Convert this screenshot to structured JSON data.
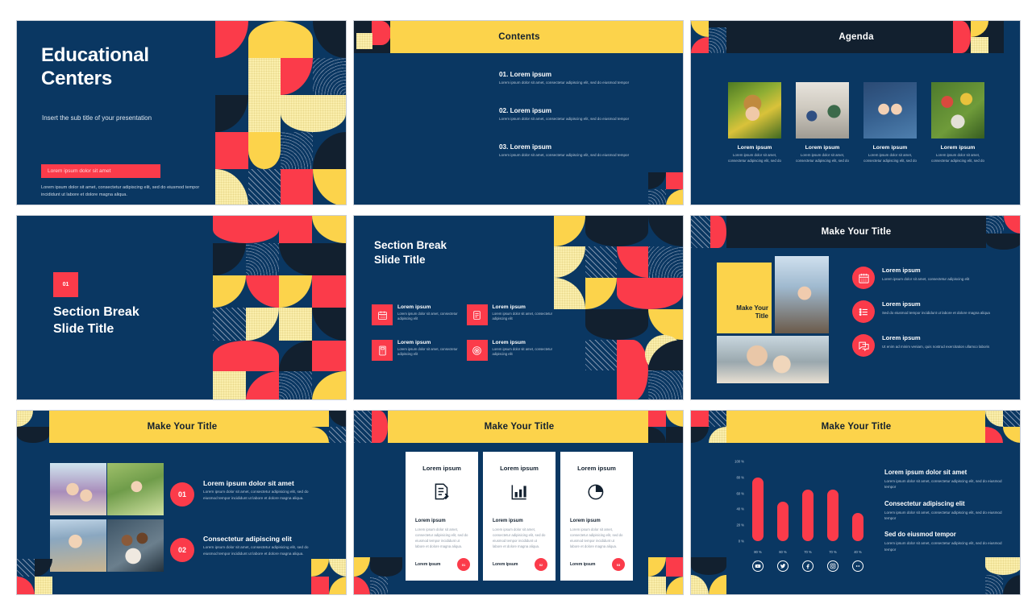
{
  "theme": {
    "navy": "#0a3762",
    "dark": "#12202f",
    "red": "#fb3b4a",
    "yellow": "#fcd34b",
    "cream": "#faeeac",
    "white": "#ffffff"
  },
  "slide1": {
    "title_line1": "Educational",
    "title_line2": "Centers",
    "subtitle": "Insert the sub title of your presentation",
    "highlight_bar": "Lorem ipsum dolor sit amet",
    "body": "Lorem ipsum dolor sit amet, consectetur adipiscing elit, sed do eiusmod tempor incididunt ut labore et dolore magna aliqua."
  },
  "slide2": {
    "header": "Contents",
    "items": [
      {
        "heading": "01. Lorem ipsum",
        "text": "Lorem ipsum dolor sit amet, consectetur adipiscing elit, sed do eiusmod tempor"
      },
      {
        "heading": "02. Lorem ipsum",
        "text": "Lorem ipsum dolor sit amet, consectetur adipiscing elit, sed do eiusmod tempor"
      },
      {
        "heading": "03. Lorem ipsum",
        "text": "Lorem ipsum dolor sit amet, consectetur adipiscing elit, sed do eiusmod tempor"
      }
    ]
  },
  "slide3": {
    "header": "Agenda",
    "cards": [
      {
        "heading": "Lorem ipsum",
        "text": "Lorem ipsum dolor sit amet, consectetur adipiscing elit, sed do",
        "image": "girl-in-flowers-photo"
      },
      {
        "heading": "Lorem ipsum",
        "text": "Lorem ipsum dolor sit amet, consectetur adipiscing elit, sed do",
        "image": "classroom-group-photo"
      },
      {
        "heading": "Lorem ipsum",
        "text": "Lorem ipsum dolor sit amet, consectetur adipiscing elit, sed do",
        "image": "science-kids-photo"
      },
      {
        "heading": "Lorem ipsum",
        "text": "Lorem ipsum dolor sit amet, consectetur adipiscing elit, sed do",
        "image": "kids-on-grass-photo"
      }
    ]
  },
  "slide4": {
    "badge": "01",
    "title_line1": "Section Break",
    "title_line2": "Slide Title"
  },
  "slide5": {
    "title_line1": "Section Break",
    "title_line2": "Slide Title",
    "items": [
      {
        "icon": "calendar-icon",
        "heading": "Lorem ipsum",
        "text": "Lorem ipsum dolor sit amet, consectetur adipiscing elit"
      },
      {
        "icon": "document-icon",
        "heading": "Lorem ipsum",
        "text": "Lorem ipsum dolor sit amet, consectetur adipiscing elit"
      },
      {
        "icon": "calculator-icon",
        "heading": "Lorem ipsum",
        "text": "Lorem ipsum dolor sit amet, consectetur adipiscing elit"
      },
      {
        "icon": "target-icon",
        "heading": "Lorem ipsum",
        "text": "Lorem ipsum dolor sit amet, consectetur adipiscing elit"
      }
    ]
  },
  "slide6": {
    "header": "Make Your Title",
    "panel_title": "Make Your Title",
    "image1": "boy-reading-outdoors-photo",
    "image2": "mother-and-child-laptop-photo",
    "items": [
      {
        "icon": "calendar-icon",
        "heading": "Lorem ipsum",
        "text": "Lorem ipsum dolor sit amet, consectetur adipiscing elit"
      },
      {
        "icon": "list-icon",
        "heading": "Lorem ipsum",
        "text": "Sed do eiusmod tempor incididunt ut labore et dolore magna aliqua"
      },
      {
        "icon": "chat-icon",
        "heading": "Lorem ipsum",
        "text": "Ut enim ad minim veniam, quis nostrud exercitation ullamco laboris"
      }
    ]
  },
  "slide7": {
    "header": "Make Your Title",
    "photos": [
      "girl-reading-book-photo",
      "girl-bubbles-photo",
      "teacher-with-boy-photo",
      "kids-with-football-photo"
    ],
    "rows": [
      {
        "number": "01",
        "heading": "Lorem ipsum dolor sit amet",
        "text": "Lorem ipsum dolor sit amet, consectetur adipisicing elit, sed do eiusmod tempor incididunt ut labore et dolore magna aliqua."
      },
      {
        "number": "02",
        "heading": "Consectetur adipiscing elit",
        "text": "Lorem ipsum dolor sit amet, consectetur adipisicing elit, sed do eiusmod tempor incididunt ut labore et dolore magna aliqua."
      }
    ]
  },
  "slide8": {
    "header": "Make Your Title",
    "cards": [
      {
        "heading": "Lorem ipsum",
        "icon": "document-edit-icon",
        "subheading": "Lorem ipsum",
        "text": "Lorem ipsum dolor sit amet, consectetur adipisicing elit, sed do eiusmod tempor incididunt ut labore et dolore magna aliqua.",
        "footer_label": "Lorem ipsum",
        "footer_badge": "01"
      },
      {
        "heading": "Lorem ipsum",
        "icon": "bar-chart-icon",
        "subheading": "Lorem ipsum",
        "text": "Lorem ipsum dolor sit amet, consectetur adipisicing elit, sed do eiusmod tempor incididunt ut labore et dolore magna aliqua.",
        "footer_label": "Lorem ipsum",
        "footer_badge": "02"
      },
      {
        "heading": "Lorem ipsum",
        "icon": "pie-chart-icon",
        "subheading": "Lorem ipsum",
        "text": "Lorem ipsum dolor sit amet, consectetur adipisicing elit, sed do eiusmod tempor incididunt ut labore et dolore magna aliqua.",
        "footer_label": "Lorem ipsum",
        "footer_badge": "03"
      }
    ]
  },
  "slide9": {
    "header": "Make Your Title",
    "social_icons": [
      "youtube-icon",
      "twitter-icon",
      "facebook-icon",
      "instagram-icon",
      "more-dots-icon"
    ],
    "list": [
      {
        "heading": "Lorem ipsum dolor sit amet",
        "text": "Lorem ipsum dolor sit amet, consectetur adipiscing elit, sed do eiusmod tempor"
      },
      {
        "heading": "Consectetur adipiscing elit",
        "text": "Lorem ipsum dolor sit amet, consectetur adipiscing elit, sed do eiusmod tempor"
      },
      {
        "heading": "Sed do eiusmod tempor",
        "text": "Lorem ipsum dolor sit amet, consectetur adipiscing elit, sed do eiusmod tempor"
      }
    ]
  },
  "chart_data": {
    "type": "bar",
    "title": "Make Your Title",
    "categories": [
      "youtube-icon",
      "twitter-icon",
      "facebook-icon",
      "instagram-icon",
      "more-dots-icon"
    ],
    "data_labels": [
      "80 %",
      "60 %",
      "70 %",
      "70 %",
      "40 %"
    ],
    "values": [
      80,
      50,
      65,
      65,
      35
    ],
    "ylabel": "",
    "xlabel": "",
    "ytick_labels": [
      "100 %",
      "80 %",
      "60 %",
      "40 %",
      "20 %",
      "0 %"
    ],
    "ytick_values": [
      100,
      80,
      60,
      40,
      20,
      0
    ],
    "ylim": [
      0,
      100
    ],
    "grid": false,
    "legend": "none",
    "bar_color": "#fb3b4a"
  }
}
